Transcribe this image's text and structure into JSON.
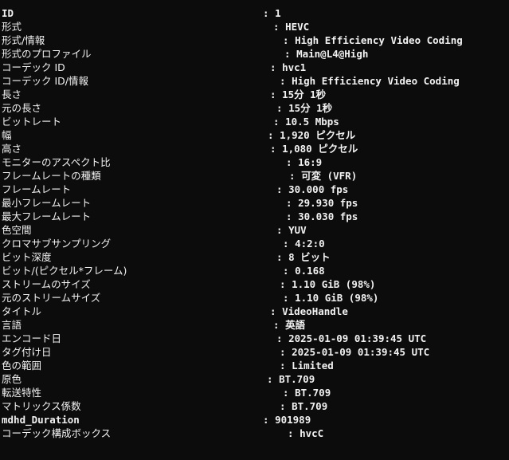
{
  "rows": [
    {
      "key": "ID",
      "value": "1"
    },
    {
      "key": "形式",
      "value": "HEVC"
    },
    {
      "key": "形式/情報",
      "value": "High Efficiency Video Coding"
    },
    {
      "key": "形式のプロファイル",
      "value": "Main@L4@High"
    },
    {
      "key": "コーデック ID",
      "value": "hvc1"
    },
    {
      "key": "コーデック ID/情報",
      "value": "High Efficiency Video Coding"
    },
    {
      "key": "長さ",
      "value": "15分 1秒"
    },
    {
      "key": "元の長さ",
      "value": "15分 1秒"
    },
    {
      "key": "ビットレート",
      "value": "10.5 Mbps"
    },
    {
      "key": "幅",
      "value": "1,920 ピクセル"
    },
    {
      "key": "高さ",
      "value": "1,080 ピクセル"
    },
    {
      "key": "モニターのアスペクト比",
      "value": "16:9"
    },
    {
      "key": "フレームレートの種類",
      "value": "可変 (VFR)"
    },
    {
      "key": "フレームレート",
      "value": "30.000 fps"
    },
    {
      "key": "最小フレームレート",
      "value": "29.930 fps"
    },
    {
      "key": "最大フレームレート",
      "value": "30.030 fps"
    },
    {
      "key": "色空間",
      "value": "YUV"
    },
    {
      "key": "クロマサブサンプリング",
      "value": "4:2:0"
    },
    {
      "key": "ビット深度",
      "value": "8 ビット"
    },
    {
      "key": "ビット/(ピクセル*フレーム)",
      "value": "0.168"
    },
    {
      "key": "ストリームのサイズ",
      "value": "1.10 GiB (98%)"
    },
    {
      "key": "元のストリームサイズ",
      "value": "1.10 GiB (98%)"
    },
    {
      "key": "タイトル",
      "value": "VideoHandle"
    },
    {
      "key": "言語",
      "value": "英語"
    },
    {
      "key": "エンコード日",
      "value": "2025-01-09 01:39:45 UTC"
    },
    {
      "key": "タグ付け日",
      "value": "2025-01-09 01:39:45 UTC"
    },
    {
      "key": "色の範囲",
      "value": "Limited"
    },
    {
      "key": "原色",
      "value": "BT.709"
    },
    {
      "key": "転送特性",
      "value": "BT.709"
    },
    {
      "key": "マトリックス係数",
      "value": "BT.709"
    },
    {
      "key": "mdhd_Duration",
      "value": "901989"
    },
    {
      "key": "コーデック構成ボックス",
      "value": "hvcC"
    }
  ],
  "colors": {
    "background": "#0c0c0c",
    "text": "#f2f2f2"
  }
}
